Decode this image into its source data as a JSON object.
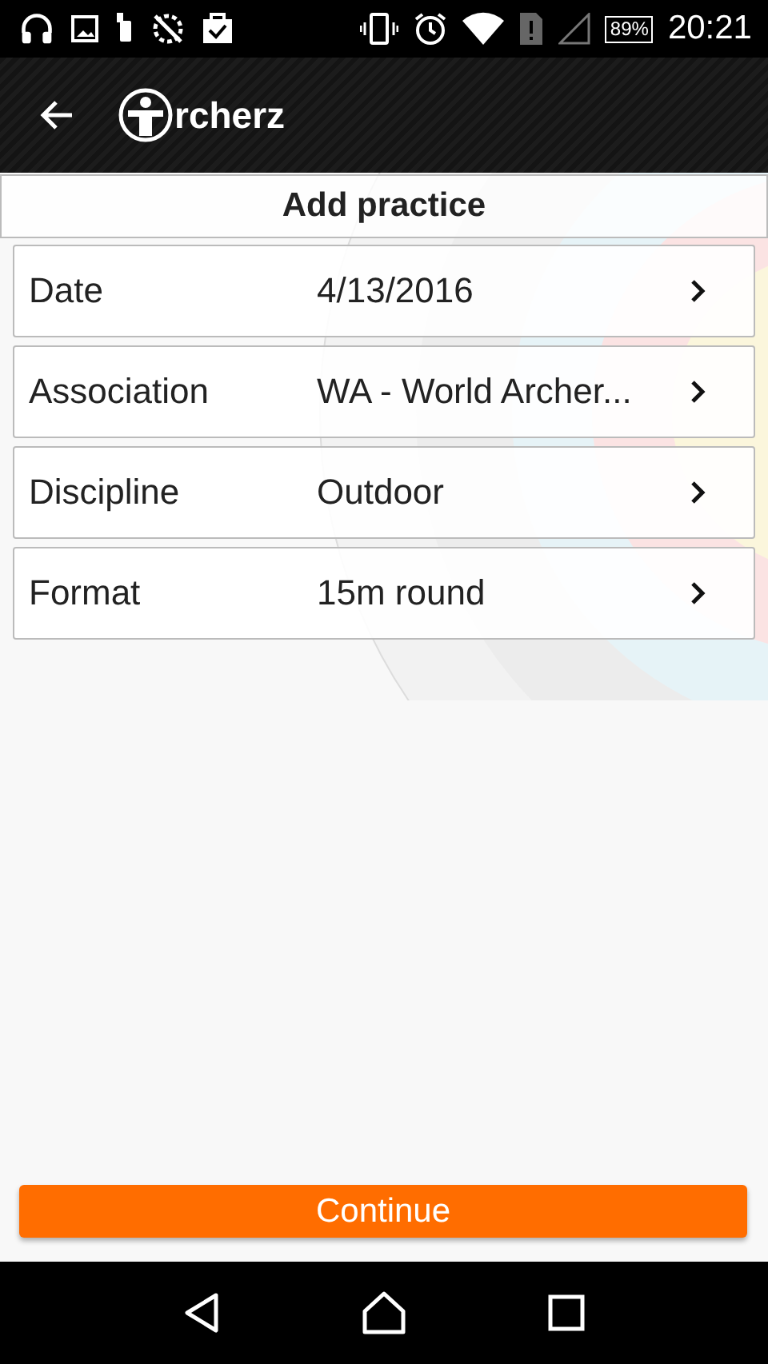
{
  "status_bar": {
    "battery": "89%",
    "time": "20:21"
  },
  "app_bar": {
    "logo_text": "rcherz"
  },
  "title": "Add practice",
  "fields": [
    {
      "label": "Date",
      "value": "4/13/2016"
    },
    {
      "label": "Association",
      "value": "WA - World Archer..."
    },
    {
      "label": "Discipline",
      "value": "Outdoor"
    },
    {
      "label": "Format",
      "value": "15m round"
    }
  ],
  "continue_button": "Continue"
}
